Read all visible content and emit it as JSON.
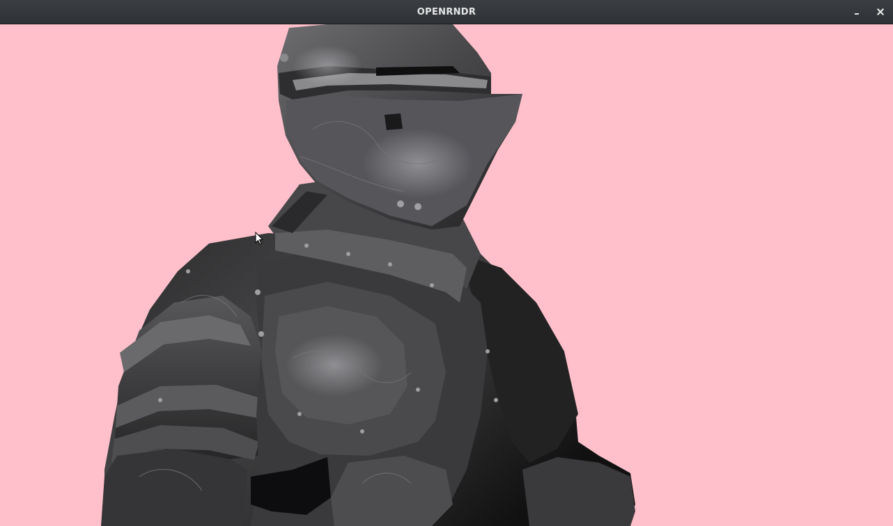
{
  "window": {
    "title": "OPENRNDR",
    "controls": {
      "minimize_icon": "minimize-icon",
      "close_icon": "close-icon"
    }
  },
  "canvas": {
    "background_color": "#ffc0cb",
    "content": "knight-armor-3d-model"
  },
  "colors": {
    "titlebar": "#33373b",
    "title_text": "#e6e6e6",
    "armor_dark": "#1e1e1f",
    "armor_mid": "#3d3d3f",
    "armor_light": "#77777a"
  }
}
